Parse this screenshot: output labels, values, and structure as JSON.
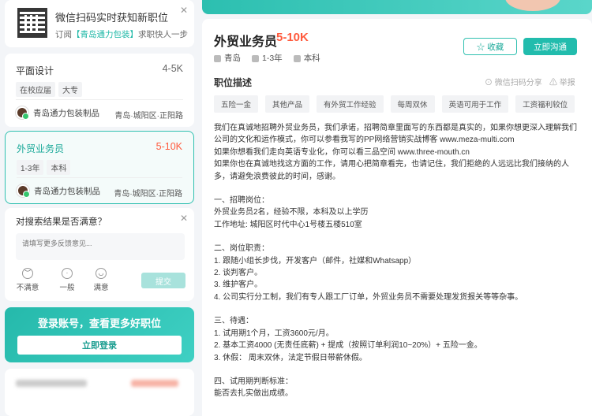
{
  "qr_card": {
    "title": "微信扫码实时获知新职位",
    "sub_prefix": "订阅",
    "sub_brand": "【青岛通力包装】",
    "sub_suffix": "求职快人一步"
  },
  "jobs": [
    {
      "title": "平面设计",
      "salary": "4-5K",
      "tags": [
        "在校应届",
        "大专"
      ],
      "company": "青岛通力包装制品",
      "location": "青岛·城阳区·正阳路"
    },
    {
      "title": "外贸业务员",
      "salary": "5-10K",
      "tags": [
        "1-3年",
        "本科"
      ],
      "company": "青岛通力包装制品",
      "location": "青岛·城阳区·正阳路"
    }
  ],
  "survey": {
    "question": "对搜索结果是否满意？",
    "placeholder": "请填写更多反馈意见...",
    "options": [
      "不满意",
      "一般",
      "满意"
    ],
    "submit": "提交"
  },
  "login": {
    "title": "登录账号，查看更多好职位",
    "button": "立即登录"
  },
  "detail": {
    "title": "外贸业务员",
    "salary": "5-10K",
    "city": "青岛",
    "experience": "1-3年",
    "education": "本科",
    "fav_label": "收藏",
    "chat_label": "立即沟通",
    "desc_heading": "职位描述",
    "share_label": "微信扫码分享",
    "report_label": "举报",
    "tags": [
      "五险一金",
      "其他产品",
      "有外贸工作经验",
      "每周双休",
      "英语可用于工作",
      "工资福利较位"
    ],
    "paragraphs": [
      "我们在真诚地招聘外贸业务员，我们承诺，招聘简章里面写的东西都是真实的，如果你想更深入理解我们公司的文化和运作模式，你可以参看我写的PP网络营销实战博客 www.meza-multi.com\n如果你想看我们走向英语专业化，你可以看三品空间 www.three-mouth.cn\n如果你也在真诚地找这方面的工作，请用心把简章看完，也请记住，我们拒绝的人远远比我们接纳的人多，请避免浪费彼此的时间，感谢。",
      "一、招聘岗位：\n外贸业务员2名，经验不限，本科及以上学历\n工作地址: 城阳区时代中心1号楼五楼510室",
      "二、岗位职责：\n1. 跟随小组长步伐，开发客户（邮件，社媒和Whatsapp）\n2. 谈判客户。\n3. 维护客户。\n4. 公司实行分工制，我们有专人跟工厂订单，外贸业务员不需要处理发货报关等等杂事。",
      "三、待遇：\n1. 试用期1个月，工资3600元/月。\n2. 基本工资4000 (无责任底薪) + 提成（按照订单利润10~20%）+ 五险一金。\n3. 休假： 周末双休，法定节假日带薪休假。",
      "四、试用期判断标准：\n能否去扎实做出成绩。"
    ]
  }
}
